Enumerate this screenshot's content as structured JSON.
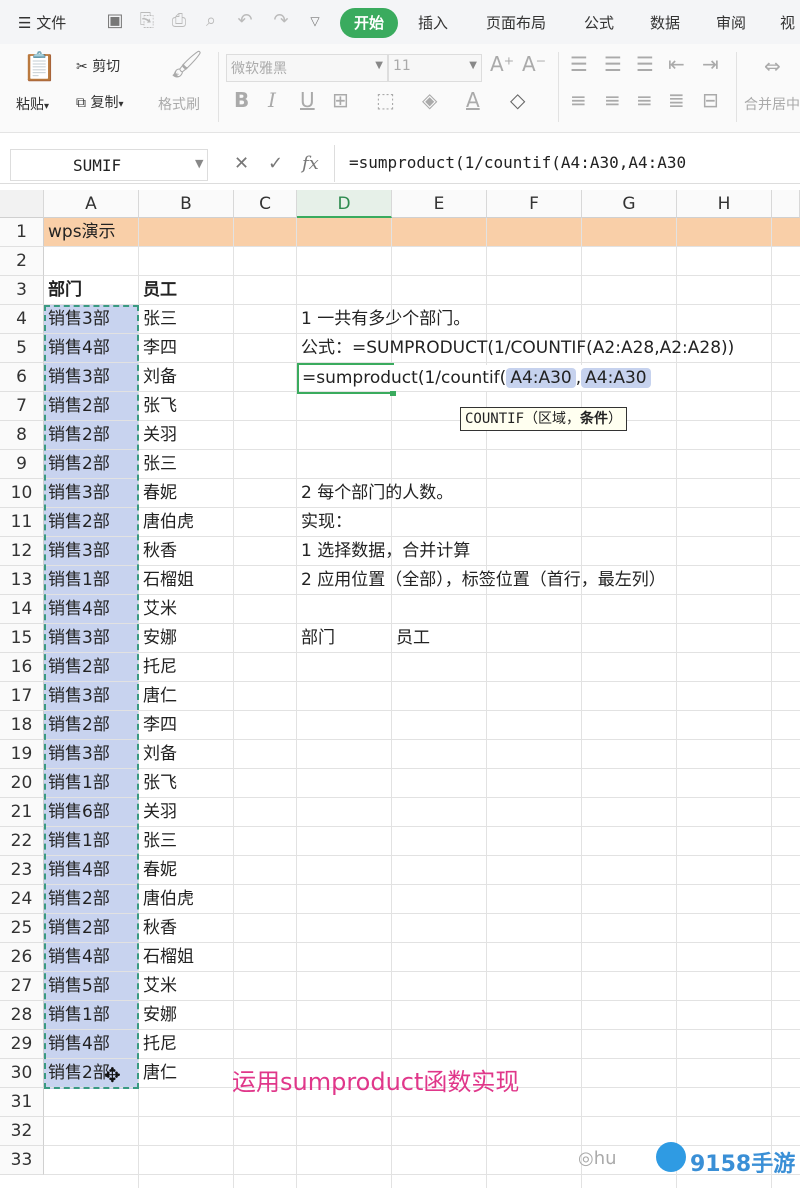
{
  "menubar": {
    "file_label": "文件",
    "tabs": [
      "开始",
      "插入",
      "页面布局",
      "公式",
      "数据",
      "审阅",
      "视"
    ]
  },
  "ribbon": {
    "paste": "粘贴",
    "cut": "剪切",
    "copy": "复制",
    "format_painter": "格式刷",
    "font_name": "微软雅黑",
    "font_size": "11",
    "merge_center": "合并居中"
  },
  "formula_bar": {
    "name_box": "SUMIF",
    "formula": "=sumproduct(1/countif(A4:A30,A4:A30"
  },
  "sheet": {
    "columns": [
      "A",
      "B",
      "C",
      "D",
      "E",
      "F",
      "G",
      "H"
    ],
    "active_column": "D",
    "row_numbers": [
      "1",
      "2",
      "3",
      "4",
      "5",
      "6",
      "7",
      "8",
      "9",
      "10",
      "11",
      "12",
      "13",
      "14",
      "15",
      "16",
      "17",
      "18",
      "19",
      "20",
      "21",
      "22",
      "23",
      "24",
      "25",
      "26",
      "27",
      "28",
      "29",
      "30",
      "31",
      "32",
      "33"
    ],
    "title_cell": "wps演示",
    "header_a": "部门",
    "header_b": "员工",
    "departments": [
      "销售3部",
      "销售4部",
      "销售3部",
      "销售2部",
      "销售2部",
      "销售2部",
      "销售3部",
      "销售2部",
      "销售3部",
      "销售1部",
      "销售4部",
      "销售3部",
      "销售2部",
      "销售3部",
      "销售2部",
      "销售3部",
      "销售1部",
      "销售6部",
      "销售1部",
      "销售4部",
      "销售2部",
      "销售2部",
      "销售4部",
      "销售5部",
      "销售1部",
      "销售4部",
      "销售2部"
    ],
    "employees": [
      "张三",
      "李四",
      "刘备",
      "张飞",
      "关羽",
      "张三",
      "春妮",
      "唐伯虎",
      "秋香",
      "石榴姐",
      "艾米",
      "安娜",
      "托尼",
      "唐仁",
      "李四",
      "刘备",
      "张飞",
      "关羽",
      "张三",
      "春妮",
      "唐伯虎",
      "秋香",
      "石榴姐",
      "艾米",
      "安娜",
      "托尼",
      "唐仁"
    ],
    "notes": {
      "d4": "1 一共有多少个部门。",
      "d5": "公式：=SUMPRODUCT(1/COUNTIF(A2:A28,A2:A28))",
      "d10": "2 每个部门的人数。",
      "d11": "实现：",
      "d12": "1 选择数据，合并计算",
      "d13": "2 应用位置（全部），标签位置（首行，最左列）",
      "d15": "部门",
      "e15": "员工"
    },
    "editor": {
      "prefix": "=sumproduct(1/countif(",
      "ref1": "A4:A30",
      "sep": ",",
      "ref2": "A4:A30"
    },
    "tooltip": {
      "func": "COUNTIF（区域，",
      "arg": "条件",
      "close": "）"
    }
  },
  "caption": "运用sumproduct函数实现",
  "watermark": {
    "left": "hu",
    "brand": "9158手游"
  }
}
